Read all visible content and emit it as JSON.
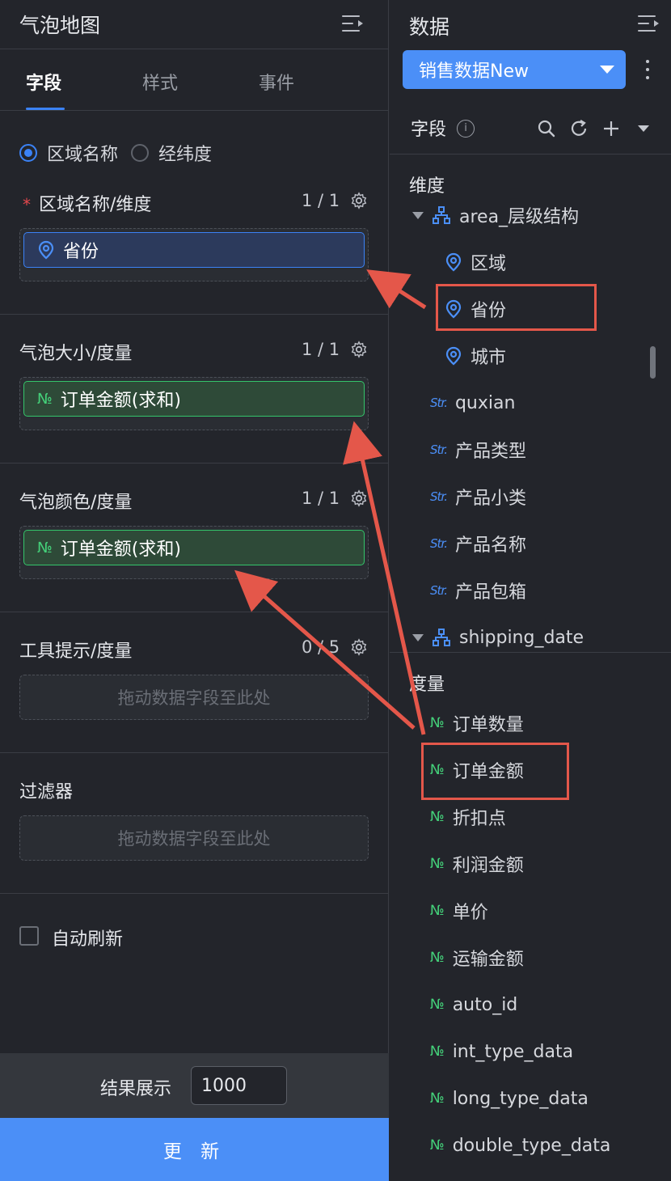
{
  "left_panel": {
    "title": "气泡地图",
    "tabs": [
      "字段",
      "样式",
      "事件"
    ],
    "radio_options": [
      "区域名称",
      "经纬度"
    ],
    "sections": [
      {
        "label": "区域名称/维度",
        "count": "1 / 1",
        "pill": "省份"
      },
      {
        "label": "气泡大小/度量",
        "count": "1 / 1",
        "pill": "订单金额(求和)",
        "icon": "№"
      },
      {
        "label": "气泡颜色/度量",
        "count": "1 / 1",
        "pill": "订单金额(求和)",
        "icon": "№"
      },
      {
        "label": "工具提示/度量",
        "count": "0 / 5",
        "placeholder": "拖动数据字段至此处"
      },
      {
        "label": "过滤器",
        "placeholder": "拖动数据字段至此处"
      }
    ],
    "required_mark": "*",
    "auto_refresh": "自动刷新",
    "result_label": "结果展示",
    "result_value": "1000",
    "update_button": "更 新"
  },
  "right_panel": {
    "title": "数据",
    "dataset": "销售数据New",
    "fields_label": "字段",
    "info_icon": "i",
    "dimension_title": "维度",
    "measure_title": "度量",
    "dimension_items": [
      {
        "type": "hier",
        "label": "area_层级结构"
      },
      {
        "type": "geo",
        "label": "区域"
      },
      {
        "type": "geo",
        "label": "省份"
      },
      {
        "type": "geo",
        "label": "城市"
      },
      {
        "type": "str",
        "label": "quxian"
      },
      {
        "type": "str",
        "label": "产品类型"
      },
      {
        "type": "str",
        "label": "产品小类"
      },
      {
        "type": "str",
        "label": "产品名称"
      },
      {
        "type": "str",
        "label": "产品包箱"
      },
      {
        "type": "hier",
        "label": "shipping_date"
      }
    ],
    "measure_items": [
      "订单数量",
      "订单金额",
      "折扣点",
      "利润金额",
      "单价",
      "运输金额",
      "auto_id",
      "int_type_data",
      "long_type_data",
      "double_type_data"
    ],
    "str_icon": "Str.",
    "num_icon": "№"
  },
  "colors": {
    "accent": "#4b8ff7",
    "dimension_border": "#3b82f6",
    "measure_border": "#34c46a",
    "annotation": "#e4574a"
  }
}
